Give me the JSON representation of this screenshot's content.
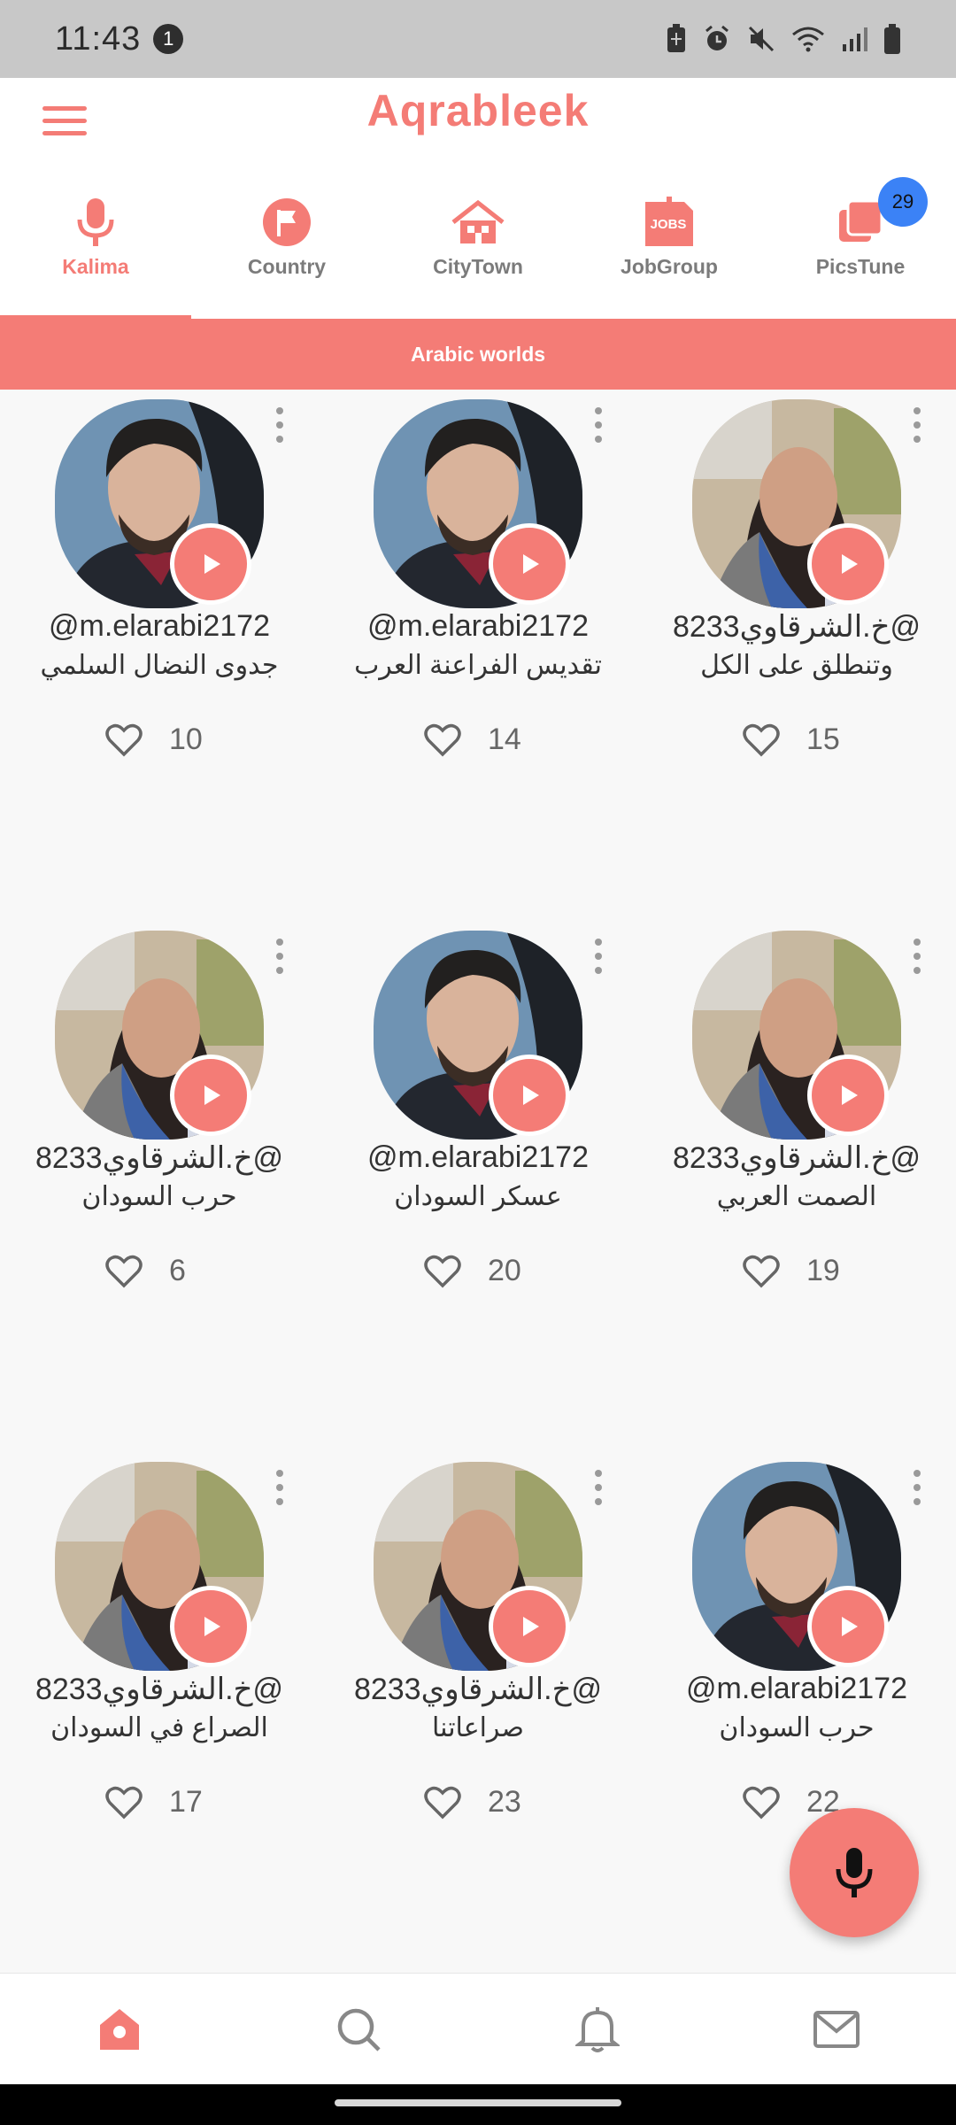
{
  "status_bar": {
    "time": "11:43",
    "notification_count": "1",
    "icons": [
      "battery-saver-icon",
      "alarm-icon",
      "mute-icon",
      "wifi-icon",
      "signal-icon",
      "battery-icon"
    ]
  },
  "header": {
    "brand": "Aqrableek",
    "menu_icon": "hamburger-menu-icon"
  },
  "tabs": [
    {
      "label": "Kalima",
      "icon": "microphone-icon",
      "active": true
    },
    {
      "label": "Country",
      "icon": "flag-icon",
      "active": false
    },
    {
      "label": "CityTown",
      "icon": "house-icon",
      "active": false
    },
    {
      "label": "JobGroup",
      "icon": "jobs-icon",
      "active": false,
      "icon_text": "JOBS"
    },
    {
      "label": "PicsTune",
      "icon": "photos-icon",
      "active": false,
      "badge": "29"
    }
  ],
  "banner": {
    "text": "Arabic worlds"
  },
  "posts": [
    {
      "handle": "@m.elarabi2172",
      "title": "جدوى النضال السلمي",
      "likes": "10",
      "avatar": "man"
    },
    {
      "handle": "@m.elarabi2172",
      "title": "تقديس الفراعنة العرب",
      "likes": "14",
      "avatar": "man"
    },
    {
      "handle": "خ.الشرقاوي8233@",
      "title": "وتنطلق على الكل",
      "likes": "15",
      "avatar": "woman"
    },
    {
      "handle": "خ.الشرقاوي8233@",
      "title": "حرب السودان",
      "likes": "6",
      "avatar": "woman"
    },
    {
      "handle": "@m.elarabi2172",
      "title": "عسكر السودان",
      "likes": "20",
      "avatar": "man"
    },
    {
      "handle": "خ.الشرقاوي8233@",
      "title": "الصمت العربي",
      "likes": "19",
      "avatar": "woman"
    },
    {
      "handle": "خ.الشرقاوي8233@",
      "title": "الصراع في السودان",
      "likes": "17",
      "avatar": "woman"
    },
    {
      "handle": "خ.الشرقاوي8233@",
      "title": "صراعاتنا",
      "likes": "23",
      "avatar": "woman"
    },
    {
      "handle": "@m.elarabi2172",
      "title": "حرب السودان",
      "likes": "22",
      "avatar": "man"
    }
  ],
  "fab": {
    "icon": "microphone-icon"
  },
  "bottom_nav": [
    {
      "name": "home",
      "icon": "home-icon",
      "active": true
    },
    {
      "name": "search",
      "icon": "search-icon",
      "active": false
    },
    {
      "name": "notifications",
      "icon": "bell-icon",
      "active": false
    },
    {
      "name": "messages",
      "icon": "mail-icon",
      "active": false
    }
  ],
  "colors": {
    "accent": "#f47c76",
    "badge": "#3b82f6",
    "inactive": "#7b7b7b"
  }
}
